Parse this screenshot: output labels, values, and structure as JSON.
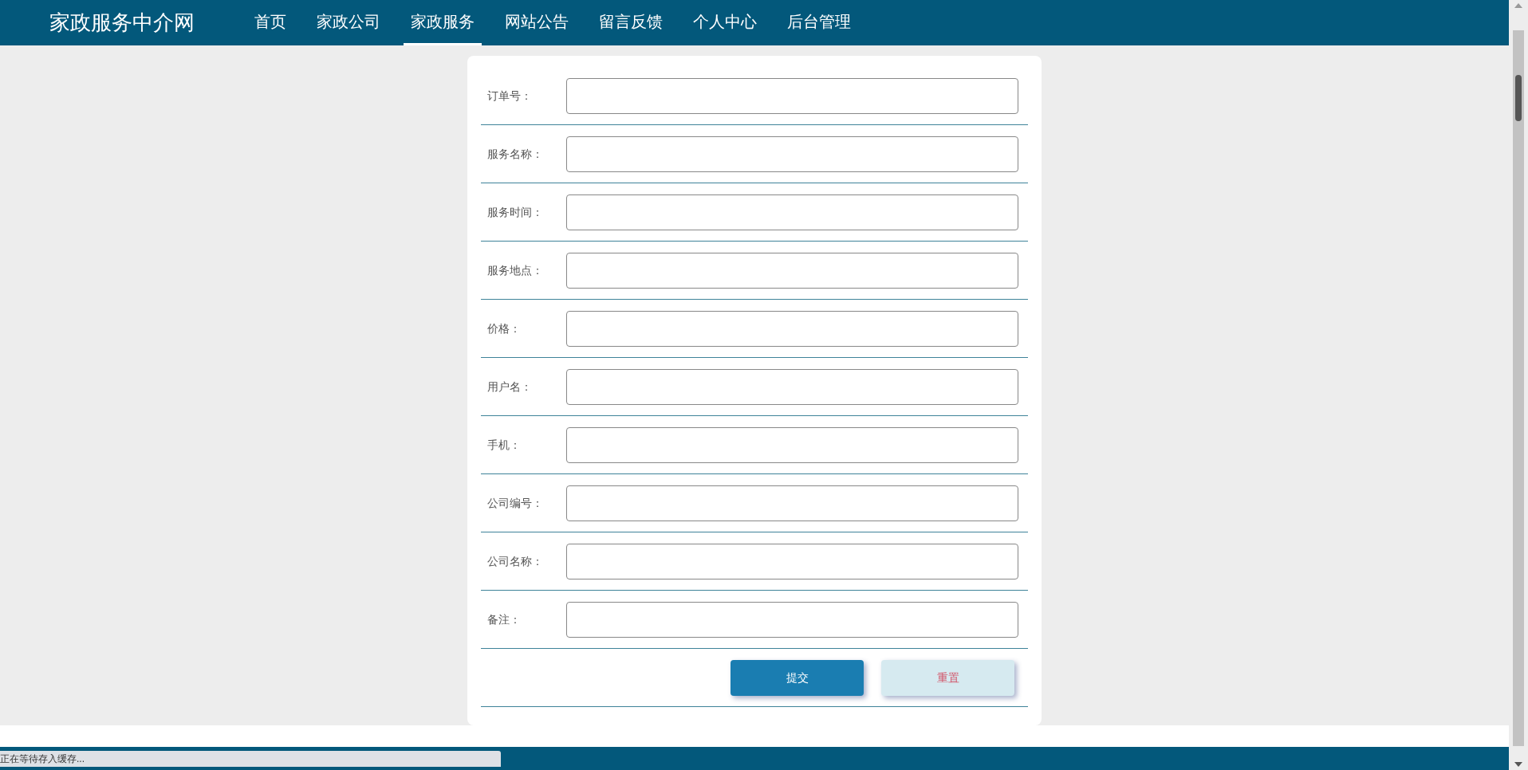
{
  "header": {
    "site_title": "家政服务中介网",
    "nav": [
      {
        "label": "首页",
        "selected": false
      },
      {
        "label": "家政公司",
        "selected": false
      },
      {
        "label": "家政服务",
        "selected": true
      },
      {
        "label": "网站公告",
        "selected": false
      },
      {
        "label": "留言反馈",
        "selected": false
      },
      {
        "label": "个人中心",
        "selected": false
      },
      {
        "label": "后台管理",
        "selected": false
      }
    ]
  },
  "form": {
    "fields": [
      {
        "label": "订单号："
      },
      {
        "label": "服务名称："
      },
      {
        "label": "服务时间："
      },
      {
        "label": "服务地点："
      },
      {
        "label": "价格："
      },
      {
        "label": "用户名："
      },
      {
        "label": "手机："
      },
      {
        "label": "公司编号："
      },
      {
        "label": "公司名称："
      },
      {
        "label": "备注："
      }
    ],
    "buttons": [
      {
        "label": "提交",
        "kind": "primary"
      },
      {
        "label": "重置",
        "kind": "secondary"
      }
    ]
  },
  "status_bar": {
    "text": "正在等待存入缓存..."
  }
}
